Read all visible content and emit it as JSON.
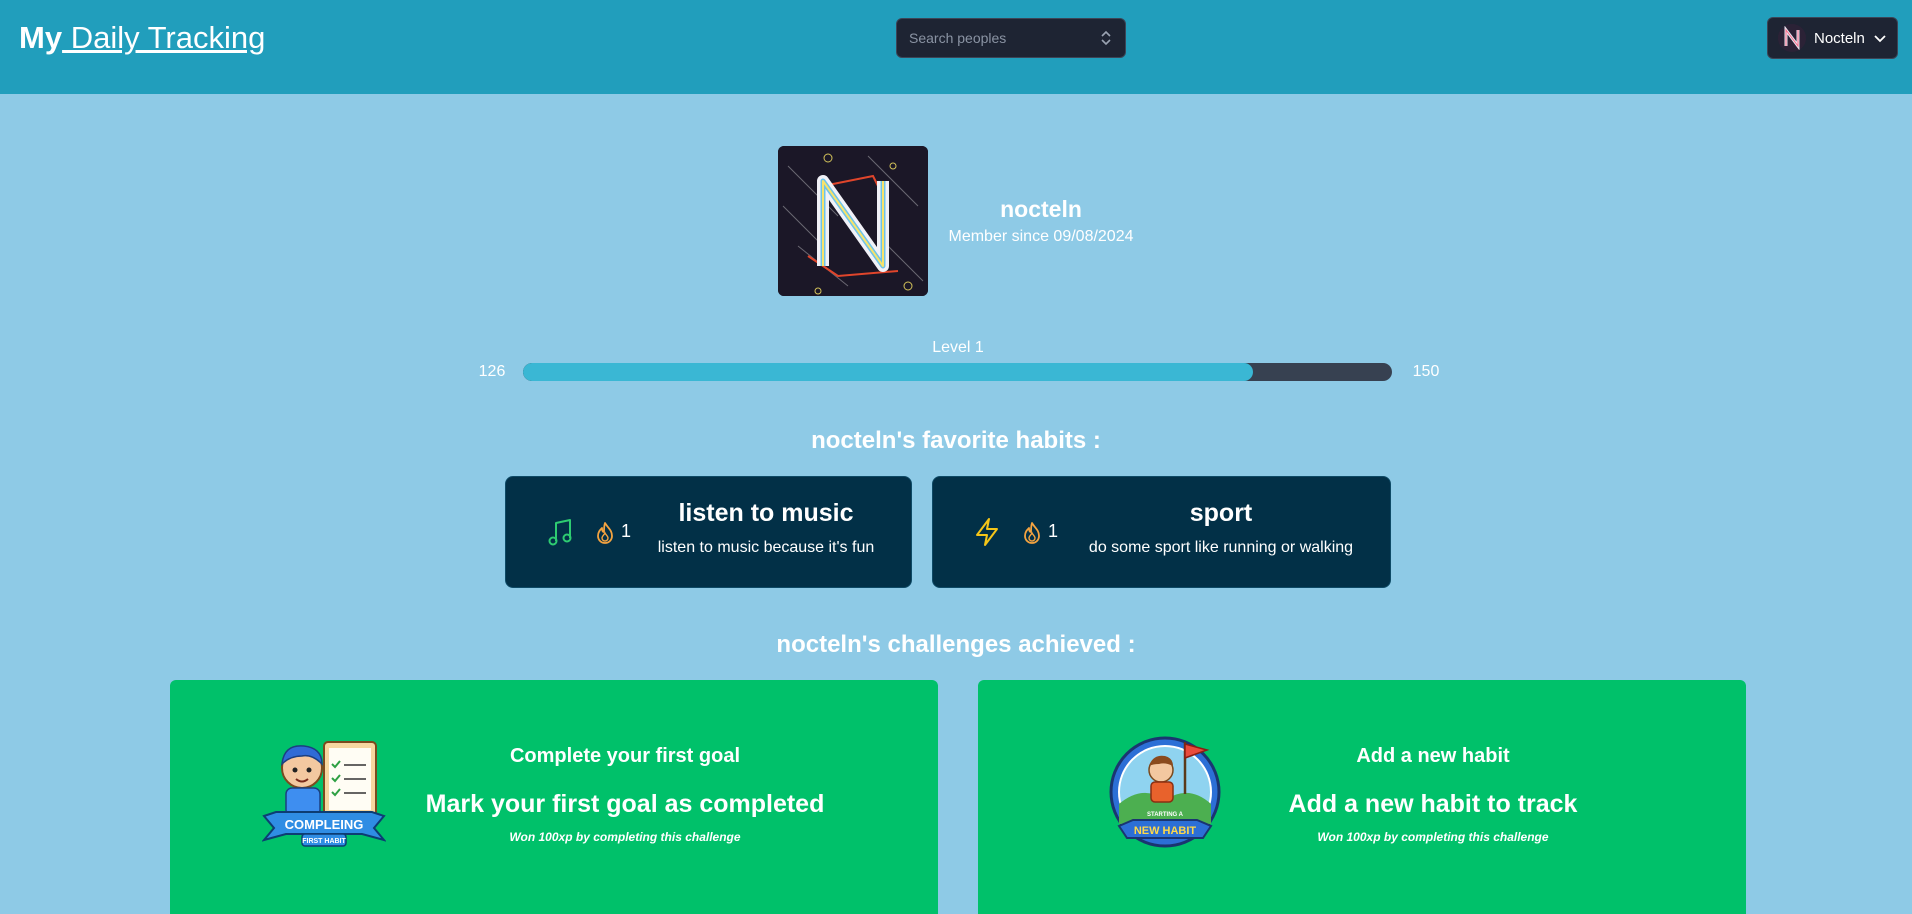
{
  "header": {
    "brand_my": "My",
    "brand_rest": " Daily Tracking",
    "search_placeholder": "Search peoples",
    "user_name": "Nocteln"
  },
  "profile": {
    "username": "nocteln",
    "member_since": "Member since 09/08/2024"
  },
  "level": {
    "label": "Level 1",
    "xp_current": "126",
    "xp_next": "150",
    "progress_fraction": 0.84
  },
  "favorites": {
    "title": "nocteln's favorite habits :",
    "items": [
      {
        "icon": "music-note-icon",
        "streak": "1",
        "title": "listen to music",
        "description": "listen to music because it's fun"
      },
      {
        "icon": "lightning-icon",
        "streak": "1",
        "title": "sport",
        "description": "do some sport like running or walking"
      }
    ]
  },
  "challenges": {
    "title": "nocteln's challenges achieved :",
    "items": [
      {
        "badge": "first-goal-badge",
        "title": "Complete your first goal",
        "subtitle": "Mark your first goal as completed",
        "reward": "Won 100xp by completing this challenge",
        "badge_text": "COMPLEING",
        "badge_subtext": "FIRST HABIT"
      },
      {
        "badge": "new-habit-badge",
        "title": "Add a new habit",
        "subtitle": "Add a new habit to track",
        "reward": "Won 100xp by completing this challenge",
        "badge_text": "NEW HABIT",
        "badge_subtext": "STARTING A"
      }
    ]
  },
  "colors": {
    "header": "#219ebc",
    "background": "#8ecae6",
    "habit_card": "#023047",
    "challenge_card": "#00c16a",
    "progress_fill": "#3ab7d4",
    "progress_track": "#374151"
  }
}
